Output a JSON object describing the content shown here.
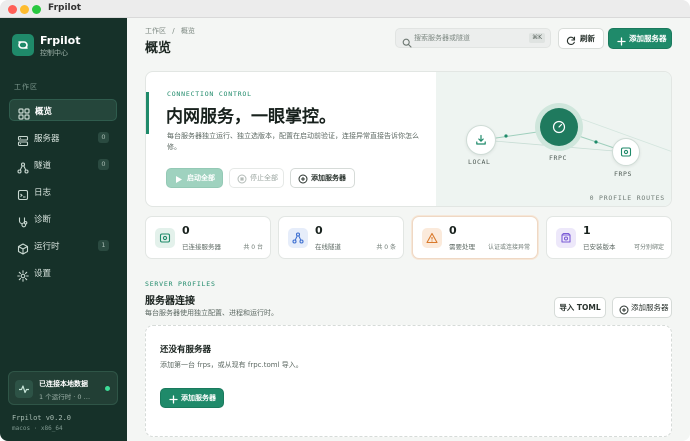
{
  "window": {
    "title": "Frpilot"
  },
  "brand": {
    "name": "Frpilot",
    "subtitle": "控制中心"
  },
  "sidebar": {
    "section": "工作区",
    "items": [
      {
        "label": "概览",
        "icon": "grid-icon",
        "active": true
      },
      {
        "label": "服务器",
        "icon": "server-icon",
        "badge": "0"
      },
      {
        "label": "隧道",
        "icon": "tunnel-icon",
        "badge": "0"
      },
      {
        "label": "日志",
        "icon": "log-icon"
      },
      {
        "label": "诊断",
        "icon": "stethoscope-icon"
      },
      {
        "label": "运行时",
        "icon": "runtime-icon",
        "badge": "1"
      },
      {
        "label": "设置",
        "icon": "gear-icon"
      }
    ],
    "status": {
      "title": "已连接本地数据",
      "subtitle": "1 个运行时 · 0 …"
    },
    "version": "Frpilot v0.2.0",
    "platform": "macos · x86_64"
  },
  "header": {
    "breadcrumb_parent": "工作区",
    "breadcrumb_sep": "/",
    "breadcrumb_current": "概览",
    "title": "概览",
    "search_placeholder": "搜索服务器或隧道",
    "search_shortcut": "⌘K",
    "refresh_label": "刷新",
    "add_server_label": "添加服务器"
  },
  "hero": {
    "eyebrow": "CONNECTION CONTROL",
    "heading": "内网服务，一眼掌控。",
    "description": "每台服务器独立运行、独立选版本，配置在启动前验证，连接异常直接告诉你怎么修。",
    "start_all": "启动全部",
    "stop_all": "停止全部",
    "add_server": "添加服务器",
    "nodes": {
      "local": "LOCAL",
      "frpc": "FRPC",
      "frps": "FRPS"
    },
    "routes": "0 PROFILE ROUTES"
  },
  "stats": [
    {
      "value": "0",
      "label": "已连接服务器",
      "note": "共 0 台",
      "icon": "server-icon",
      "color": "#1f8a6a",
      "bg": "#e3f1eb"
    },
    {
      "value": "0",
      "label": "在线隧道",
      "note": "共 0 条",
      "icon": "tunnel-icon",
      "color": "#3e6fd0",
      "bg": "#e6edfa"
    },
    {
      "value": "0",
      "label": "需要处理",
      "note": "认证或连接异常",
      "icon": "warning-icon",
      "color": "#d9792b",
      "bg": "#fbeadb"
    },
    {
      "value": "1",
      "label": "已安装版本",
      "note": "可分别绑定",
      "icon": "package-icon",
      "color": "#7b5bd6",
      "bg": "#ede8fa"
    }
  ],
  "profiles": {
    "eyebrow": "SERVER PROFILES",
    "title": "服务器连接",
    "description": "每台服务器使用独立配置、进程和运行时。",
    "import_label": "导入 TOML",
    "add_label": "添加服务器",
    "empty_title": "还没有服务器",
    "empty_desc": "添加第一台 frps，或从现有 frpc.toml 导入。",
    "empty_add_label": "添加服务器"
  },
  "colors": {
    "accent": "#1f8a6a",
    "sidebar_bg": "#163129",
    "status_dot": "#3ddc97"
  }
}
